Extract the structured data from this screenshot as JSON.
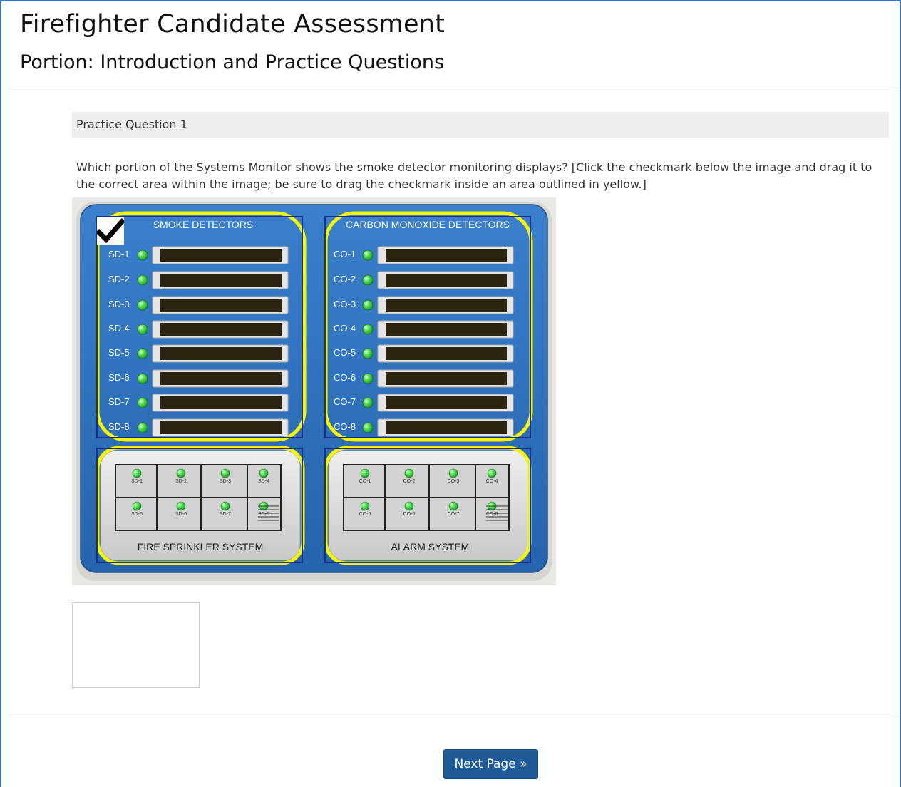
{
  "app": {
    "title": "Firefighter Candidate Assessment",
    "portion": "Portion: Introduction and Practice Questions"
  },
  "question": {
    "header": "Practice Question 1",
    "text": "Which portion of the Systems Monitor shows the smoke detector monitoring displays? [Click the checkmark below the image and drag it to the correct area within the image; be sure to drag the checkmark inside an area outlined in yellow.]"
  },
  "monitor": {
    "smoke_title": "SMOKE DETECTORS",
    "co_title": "CARBON MONOXIDE DETECTORS",
    "smoke_labels": [
      "SD-1",
      "SD-2",
      "SD-3",
      "SD-4",
      "SD-5",
      "SD-6",
      "SD-7",
      "SD-8"
    ],
    "co_labels": [
      "CO-1",
      "CO-2",
      "CO-3",
      "CO-4",
      "CO-5",
      "CO-6",
      "CO-7",
      "CO-8"
    ],
    "sprinkler_title": "FIRE SPRINKLER SYSTEM",
    "alarm_title": "ALARM SYSTEM",
    "sprinkler_rooms": [
      "SD-1",
      "SD-2",
      "SD-3",
      "SD-4",
      "SD-5",
      "SD-6",
      "SD-7",
      "SD-8"
    ],
    "alarm_rooms": [
      "CO-1",
      "CO-2",
      "CO-3",
      "CO-4",
      "CO-5",
      "CO-6",
      "CO-7",
      "CO-8"
    ],
    "colors": {
      "panel_blue": "#2f72be",
      "highlight_yellow": "#f5f500",
      "led_green": "#3ecf3e",
      "outline_navy": "#1a2f8c"
    }
  },
  "nav": {
    "next_label": "Next Page »"
  }
}
